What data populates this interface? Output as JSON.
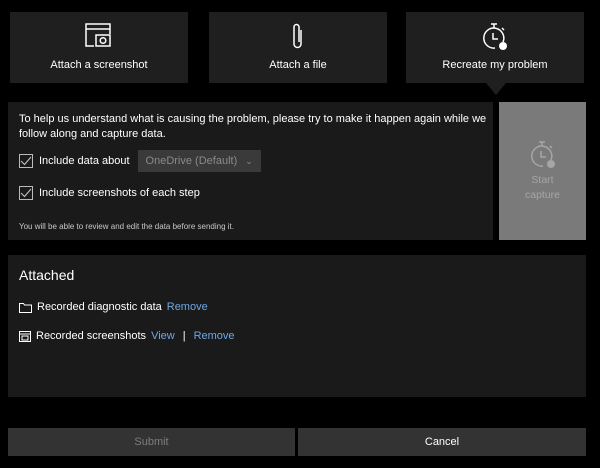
{
  "tiles": [
    {
      "label": "Attach a screenshot",
      "icon": "screenshot-camera-icon"
    },
    {
      "label": "Attach a file",
      "icon": "paperclip-icon"
    },
    {
      "label": "Recreate my problem",
      "icon": "stopwatch-record-icon"
    }
  ],
  "recreate": {
    "intro": "To help us understand what is causing the problem, please try to make it happen again while we follow along and capture data.",
    "include_data_label": "Include data about",
    "include_data_checked": true,
    "include_data_value": "OneDrive (Default)",
    "include_screenshots_label": "Include screenshots of each step",
    "include_screenshots_checked": true,
    "note": "You will be able to review and edit the data before sending it.",
    "start_line1": "Start",
    "start_line2": "capture"
  },
  "attached": {
    "title": "Attached",
    "items": [
      {
        "label": "Recorded diagnostic data",
        "remove": "Remove"
      },
      {
        "label": "Recorded screenshots",
        "view": "View",
        "separator": "|",
        "remove": "Remove"
      }
    ]
  },
  "footer": {
    "submit": "Submit",
    "cancel": "Cancel"
  },
  "colors": {
    "link": "#6ea7e6",
    "start_disabled": "#7a7a7a"
  }
}
